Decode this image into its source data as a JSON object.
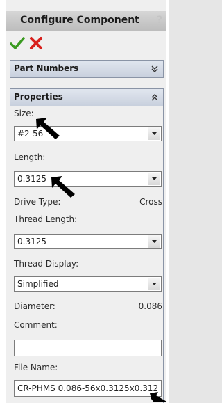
{
  "header": {
    "title": "Configure Component",
    "help_glyph": "?"
  },
  "icons": {
    "ok": "check-icon",
    "cancel": "close-icon",
    "expand": "double-chevron-down-icon",
    "collapse": "double-chevron-up-icon",
    "dropdown": "dropdown-arrow-icon",
    "pointer": "black-arrow-pointer-icon"
  },
  "colors": {
    "ok": "#3a9a20",
    "cancel": "#d8201c",
    "section_header": "#cfd6e2"
  },
  "sections": {
    "part_numbers": {
      "label": "Part Numbers",
      "expanded": false
    },
    "properties": {
      "label": "Properties",
      "expanded": true
    }
  },
  "properties": {
    "size_label": "Size:",
    "size_value": "#2-56",
    "length_label": "Length:",
    "length_value": "0.3125",
    "drive_type_label": "Drive Type:",
    "drive_type_value": "Cross",
    "thread_length_label": "Thread Length:",
    "thread_length_value": "0.3125",
    "thread_display_label": "Thread Display:",
    "thread_display_value": "Simplified",
    "diameter_label": "Diameter:",
    "diameter_value": "0.086",
    "comment_label": "Comment:",
    "comment_value": "",
    "file_name_label": "File Name:",
    "file_name_value": "CR-PHMS 0.086-56x0.3125x0.312"
  }
}
